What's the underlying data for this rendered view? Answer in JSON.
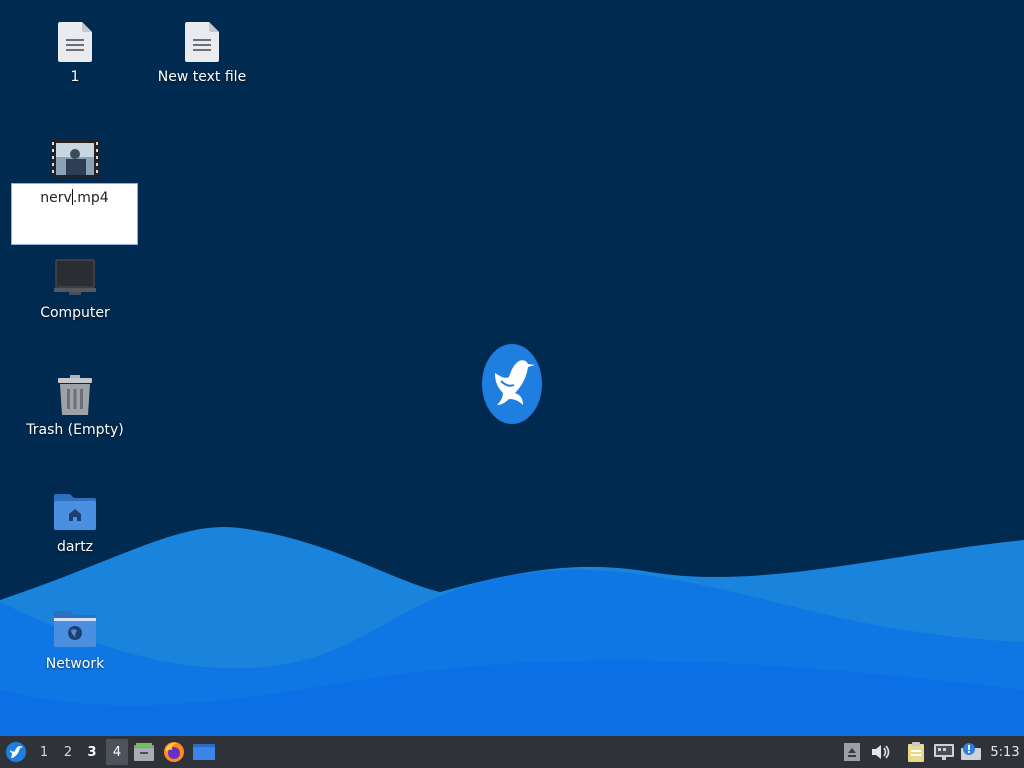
{
  "desktop": {
    "icons": [
      {
        "label": "1",
        "icon": "text-file-icon"
      },
      {
        "label": "New text file",
        "icon": "text-file-icon"
      },
      {
        "label": "Computer",
        "icon": "computer-icon"
      },
      {
        "label": "Trash (Empty)",
        "icon": "trash-icon"
      },
      {
        "label": "dartz",
        "icon": "home-folder-icon"
      },
      {
        "label": "Network",
        "icon": "network-folder-icon"
      }
    ],
    "renaming": {
      "icon": "video-thumbnail-icon",
      "text_before_caret": "nerv",
      "text_after_caret": ".mp4"
    },
    "logo": "hummingbird-logo-icon"
  },
  "taskbar": {
    "menu_icon": "start-menu-icon",
    "workspaces": [
      "1",
      "2",
      "3",
      "4"
    ],
    "current_workspace": "3",
    "launchers": [
      "file-manager-icon",
      "firefox-icon",
      "show-desktop-icon"
    ],
    "tray": [
      "eject-icon",
      "volume-icon",
      "clipboard-icon",
      "network-icon",
      "update-notifier-icon"
    ],
    "clock": "5:13"
  }
}
